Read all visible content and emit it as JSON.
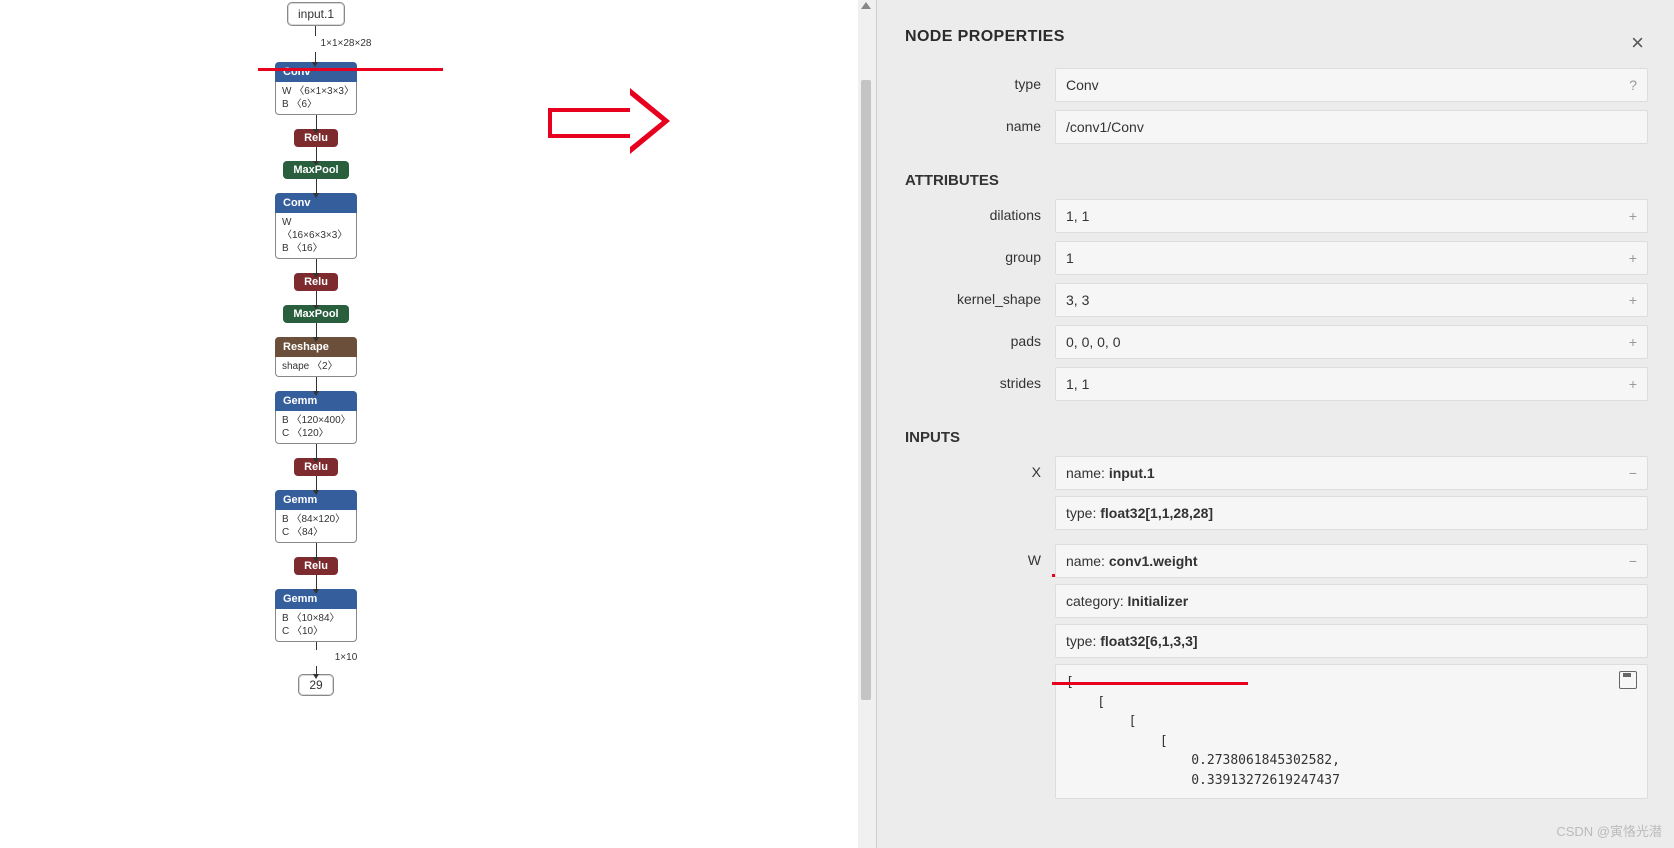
{
  "graph": {
    "input": {
      "label": "input.1",
      "out_shape": "1×1×28×28"
    },
    "nodes": [
      {
        "op": "Conv",
        "style": "blue",
        "lines": [
          "W 〈6×1×3×3〉",
          "B 〈6〉"
        ]
      },
      {
        "op": "Relu",
        "style": "red-pill"
      },
      {
        "op": "MaxPool",
        "style": "green-pill"
      },
      {
        "op": "Conv",
        "style": "blue",
        "lines": [
          "W 〈16×6×3×3〉",
          "B 〈16〉"
        ]
      },
      {
        "op": "Relu",
        "style": "red-pill"
      },
      {
        "op": "MaxPool",
        "style": "green-pill"
      },
      {
        "op": "Reshape",
        "style": "brown",
        "lines": [
          "shape 〈2〉"
        ]
      },
      {
        "op": "Gemm",
        "style": "blue",
        "lines": [
          "B 〈120×400〉",
          "C 〈120〉"
        ]
      },
      {
        "op": "Relu",
        "style": "red-pill"
      },
      {
        "op": "Gemm",
        "style": "blue",
        "lines": [
          "B 〈84×120〉",
          "C 〈84〉"
        ]
      },
      {
        "op": "Relu",
        "style": "red-pill"
      },
      {
        "op": "Gemm",
        "style": "blue",
        "lines": [
          "B 〈10×84〉",
          "C 〈10〉"
        ]
      }
    ],
    "tail_shape": "1×10",
    "tail_out": "29"
  },
  "panel": {
    "title": "NODE PROPERTIES",
    "type_label": "type",
    "type_value": "Conv",
    "name_label": "name",
    "name_value": "/conv1/Conv",
    "attrs_title": "ATTRIBUTES",
    "attrs": [
      {
        "label": "dilations",
        "value": "1, 1"
      },
      {
        "label": "group",
        "value": "1"
      },
      {
        "label": "kernel_shape",
        "value": "3, 3"
      },
      {
        "label": "pads",
        "value": "0, 0, 0, 0"
      },
      {
        "label": "strides",
        "value": "1, 1"
      }
    ],
    "inputs_title": "INPUTS",
    "X_label": "X",
    "X_name_label": "name: ",
    "X_name_value": "input.1",
    "X_type_label": "type: ",
    "X_type_value": "float32[1,1,28,28]",
    "W_label": "W",
    "W_name_label": "name: ",
    "W_name_value": "conv1.weight",
    "W_cat_label": "category: ",
    "W_cat_value": "Initializer",
    "W_type_label": "type: ",
    "W_type_value": "float32[6,1,3,3]",
    "W_tensor_lines": [
      "[",
      "    [",
      "        [",
      "            [",
      "                0.2738061845302582,",
      "                0.33913272619247437"
    ]
  },
  "watermark": "CSDN @寅恪光潜"
}
